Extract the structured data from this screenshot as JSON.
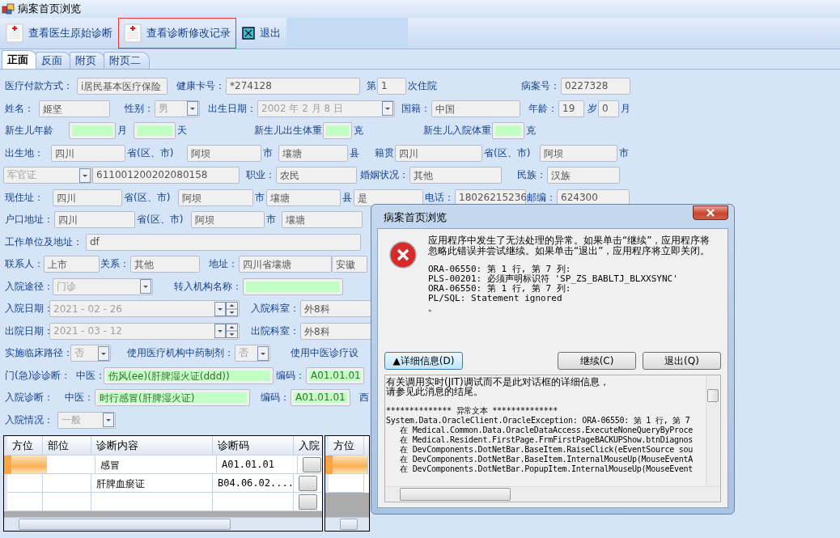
{
  "window": {
    "title": "病案首页浏览"
  },
  "toolbar": [
    {
      "label": "查看医生原始诊断",
      "kind": "document",
      "highlighted": false
    },
    {
      "label": "查看诊断修改记录",
      "kind": "document",
      "highlighted": true
    },
    {
      "label": "退出",
      "kind": "exit",
      "highlighted": false
    }
  ],
  "tabs": [
    {
      "label": "正面",
      "selected": true
    },
    {
      "label": "反面",
      "selected": false
    },
    {
      "label": "附页",
      "selected": false
    },
    {
      "label": "附页二",
      "selected": false
    }
  ],
  "form_rows": [
    {
      "items": [
        {
          "kind": "label",
          "text": "医疗付款方式："
        },
        {
          "kind": "field",
          "value": "i居民基本医疗保险",
          "highlighted": false
        },
        {
          "kind": "label",
          "text": "健康卡号："
        },
        {
          "kind": "field",
          "value": "*274128",
          "highlighted": false
        },
        {
          "kind": "label",
          "text": "第"
        },
        {
          "kind": "field",
          "value": "1",
          "highlighted": false
        },
        {
          "kind": "label",
          "text": "次住院"
        },
        {
          "kind": "label",
          "text": "病案号："
        },
        {
          "kind": "field",
          "value": "0227328",
          "highlighted": false
        }
      ]
    },
    {
      "items": [
        {
          "kind": "label",
          "text": "姓名："
        },
        {
          "kind": "field",
          "value": "姬坚",
          "highlighted": false
        },
        {
          "kind": "label",
          "text": "性别："
        },
        {
          "kind": "select",
          "value": "男",
          "disabled": true
        },
        {
          "kind": "label",
          "text": "出生日期："
        },
        {
          "kind": "date",
          "value": "2002 年 2 月 8 日",
          "disabled": true
        },
        {
          "kind": "label",
          "text": "国籍："
        },
        {
          "kind": "field",
          "value": "中国",
          "highlighted": false
        },
        {
          "kind": "label",
          "text": "年龄："
        },
        {
          "kind": "field",
          "value": "19",
          "highlighted": false
        },
        {
          "kind": "label",
          "text": "岁"
        },
        {
          "kind": "field",
          "value": "0",
          "highlighted": false
        },
        {
          "kind": "label",
          "text": "月"
        }
      ]
    },
    {
      "items": [
        {
          "kind": "label",
          "text": "新生儿年龄"
        },
        {
          "kind": "field",
          "highlighted": true
        },
        {
          "kind": "label",
          "text": "月"
        },
        {
          "kind": "field",
          "highlighted": true
        },
        {
          "kind": "label",
          "text": "天"
        },
        {
          "kind": "label",
          "text": "新生儿出生体重"
        },
        {
          "kind": "field",
          "highlighted": true
        },
        {
          "kind": "label",
          "text": "克"
        },
        {
          "kind": "label",
          "text": "新生儿入院体重"
        },
        {
          "kind": "field",
          "highlighted": true
        },
        {
          "kind": "label",
          "text": "克"
        }
      ]
    },
    {
      "items": [
        {
          "kind": "label",
          "text": "出生地："
        },
        {
          "kind": "field",
          "value": "四川",
          "highlighted": false
        },
        {
          "kind": "label",
          "text": "省(区、市)"
        },
        {
          "kind": "field",
          "value": "阿坝",
          "highlighted": false
        },
        {
          "kind": "label",
          "text": "市"
        },
        {
          "kind": "field",
          "value": "壤塘",
          "highlighted": false
        },
        {
          "kind": "label",
          "text": "县"
        },
        {
          "kind": "label",
          "text": "籍贯"
        },
        {
          "kind": "field",
          "value": "四川",
          "highlighted": false
        },
        {
          "kind": "label",
          "text": "省(区、市)"
        },
        {
          "kind": "field",
          "value": "阿坝",
          "highlighted": false
        },
        {
          "kind": "label",
          "text": "市"
        }
      ]
    },
    {
      "items": [
        {
          "kind": "select",
          "value": "军官证",
          "disabled": true
        },
        {
          "kind": "field",
          "value": "611001200202080158",
          "highlighted": false
        },
        {
          "kind": "label",
          "text": "职业："
        },
        {
          "kind": "field",
          "value": "农民",
          "highlighted": false
        },
        {
          "kind": "label",
          "text": "婚姻状况："
        },
        {
          "kind": "field",
          "value": "其他",
          "highlighted": false
        },
        {
          "kind": "label",
          "text": "民族："
        },
        {
          "kind": "field",
          "value": "汉族",
          "highlighted": false
        }
      ]
    },
    {
      "items": [
        {
          "kind": "label",
          "text": "现住址："
        },
        {
          "kind": "field",
          "value": "四川",
          "highlighted": false
        },
        {
          "kind": "label",
          "text": "省(区、市)"
        },
        {
          "kind": "field",
          "value": "阿坝",
          "highlighted": false
        },
        {
          "kind": "label",
          "text": "市"
        },
        {
          "kind": "field",
          "value": "壤塘",
          "highlighted": false
        },
        {
          "kind": "label",
          "text": "县"
        },
        {
          "kind": "field",
          "value": "是",
          "highlighted": false
        },
        {
          "kind": "label",
          "text": "电话："
        },
        {
          "kind": "field",
          "value": "18026215236",
          "highlighted": false
        },
        {
          "kind": "label",
          "text": "邮编："
        },
        {
          "kind": "field",
          "value": "624300",
          "highlighted": false
        }
      ]
    },
    {
      "items": [
        {
          "kind": "label",
          "text": "户口地址："
        },
        {
          "kind": "field",
          "value": "四川",
          "highlighted": false
        },
        {
          "kind": "label",
          "text": "省(区、市)"
        },
        {
          "kind": "field",
          "value": "阿坝",
          "highlighted": false
        },
        {
          "kind": "label",
          "text": "市"
        },
        {
          "kind": "field",
          "value": "壤塘",
          "highlighted": false
        }
      ]
    },
    {
      "items": [
        {
          "kind": "label",
          "text": "工作单位及地址："
        },
        {
          "kind": "field",
          "value": "df",
          "highlighted": false
        }
      ]
    },
    {
      "items": [
        {
          "kind": "label",
          "text": "联系人："
        },
        {
          "kind": "field",
          "value": "上市",
          "highlighted": false
        },
        {
          "kind": "label",
          "text": "关系："
        },
        {
          "kind": "field",
          "value": "其他",
          "highlighted": false
        },
        {
          "kind": "label",
          "text": "地址："
        },
        {
          "kind": "field",
          "value": "四川省壤塘",
          "highlighted": false
        },
        {
          "kind": "field",
          "value": "安徽",
          "highlighted": false
        }
      ]
    },
    {
      "items": [
        {
          "kind": "label",
          "text": "入院途径："
        },
        {
          "kind": "select",
          "value": "门诊",
          "disabled": true
        },
        {
          "kind": "label",
          "text": "转入机构名称："
        },
        {
          "kind": "field",
          "highlighted": true
        }
      ]
    },
    {
      "items": [
        {
          "kind": "label",
          "text": "入院日期："
        },
        {
          "kind": "date_spin",
          "value": "2021 - 02 - 26",
          "disabled": true
        },
        {
          "kind": "label",
          "text": "入院科室："
        },
        {
          "kind": "field",
          "value": "外8科",
          "highlighted": false
        }
      ]
    },
    {
      "items": [
        {
          "kind": "label",
          "text": "出院日期："
        },
        {
          "kind": "date_spin",
          "value": "2021 - 03 - 12",
          "disabled": true
        },
        {
          "kind": "label",
          "text": "出院科室："
        },
        {
          "kind": "field",
          "value": "外8科",
          "highlighted": false
        }
      ]
    },
    {
      "items": [
        {
          "kind": "label",
          "text": "实施临床路径："
        },
        {
          "kind": "select",
          "value": "否",
          "disabled": true
        },
        {
          "kind": "label",
          "text": "使用医疗机构中药制剂："
        },
        {
          "kind": "select",
          "value": "否",
          "disabled": true
        },
        {
          "kind": "label",
          "text": "使用中医诊疗设"
        }
      ]
    },
    {
      "items": [
        {
          "kind": "label",
          "text": "门(急)诊诊断："
        },
        {
          "kind": "label",
          "text": "中医："
        },
        {
          "kind": "field",
          "value": "伤风(ee)(肝脾湿火证(ddd))",
          "highlighted": true
        },
        {
          "kind": "label",
          "text": "编码："
        },
        {
          "kind": "field",
          "value": "A01.01.01",
          "highlighted": true
        }
      ]
    },
    {
      "items": [
        {
          "kind": "label",
          "text": "入院诊断："
        },
        {
          "kind": "label",
          "text": "中医："
        },
        {
          "kind": "field",
          "value": "时行感冒(肝脾湿火证)",
          "highlighted": true
        },
        {
          "kind": "label",
          "text": "编码："
        },
        {
          "kind": "field",
          "value": "A01.01.01",
          "highlighted": true
        },
        {
          "kind": "label",
          "text": "西"
        }
      ]
    },
    {
      "items": [
        {
          "kind": "label",
          "text": "入院情况："
        },
        {
          "kind": "select",
          "value": "一般",
          "disabled": true
        }
      ]
    }
  ],
  "grids": [
    {
      "columns": [
        {
          "label": "方位",
          "kind": "text"
        },
        {
          "label": "部位",
          "kind": "text"
        },
        {
          "label": "诊断内容",
          "kind": "text"
        },
        {
          "label": "诊断码",
          "kind": "text"
        },
        {
          "label": "入院",
          "kind": "button"
        }
      ],
      "rows": [
        {
          "selected": true,
          "cells": [
            null,
            null,
            "感冒",
            "A01.01.01",
            null
          ]
        },
        {
          "selected": false,
          "cells": [
            null,
            null,
            "肝脾血瘀证",
            "B04.06.02....",
            null
          ]
        },
        {
          "selected": false,
          "cells": [
            null,
            null,
            null,
            null,
            null
          ]
        }
      ]
    },
    {
      "columns": [
        {
          "label": "方位",
          "kind": "text"
        }
      ],
      "rows": [
        {
          "selected": true,
          "cells": [
            null
          ]
        },
        {
          "selected": false,
          "cells": [
            null
          ]
        }
      ]
    }
  ],
  "dialog": {
    "title": "病案首页浏览",
    "message": "应用程序中发生了无法处理的异常。如果单击“继续”，应用程序将忽略此错误并尝试继续。如果单击“退出”，应用程序将立即关闭。",
    "error_lines": [
      "ORA-06550: 第 1 行, 第 7 列:",
      "PLS-00201: 必须声明标识符 'SP_ZS_BABLTJ_BLXXSYNC'",
      "ORA-06550: 第 1 行, 第 7 列:",
      "PL/SQL: Statement ignored",
      "。"
    ],
    "details_button": "▲详细信息(D)",
    "buttons": [
      "继续(C)",
      "退出(Q)"
    ],
    "details_intro": [
      "有关调用实时(JIT)调试而不是此对话框的详细信息，",
      "请参见此消息的结尾。"
    ],
    "details_trace": [
      "************** 异常文本 **************",
      "System.Data.OracleClient.OracleException: ORA-06550: 第 1 行, 第 7",
      "   在 Medical.Common.Data.OracleDataAccess.ExecuteNoneQueryByProce",
      "   在 Medical.Resident.FirstPage.FrmFirstPageBACKUPShow.btnDiagnos",
      "   在 DevComponents.DotNetBar.BaseItem.RaiseClick(eEventSource sou",
      "   在 DevComponents.DotNetBar.BaseItem.InternalMouseUp(MouseEventA",
      "   在 DevComponents.DotNetBar.PopupItem.InternalMouseUp(MouseEvent"
    ]
  }
}
